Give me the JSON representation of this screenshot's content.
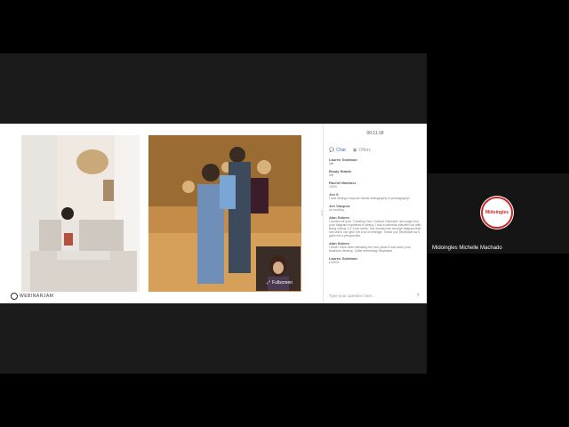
{
  "stage": {
    "brand": "WEBINARJAM",
    "fullscreen_label": "Fullscreen"
  },
  "chat": {
    "timer": "00:11:18",
    "tabs": [
      {
        "label": "Chat",
        "active": true
      },
      {
        "label": "Offers",
        "active": false
      }
    ],
    "messages": [
      {
        "name": "Lauren Goldman",
        "text": "hiiii"
      },
      {
        "name": "Brady Statzle",
        "text": "hiiii"
      },
      {
        "name": "Rachel Martinez",
        "text": "100%"
      },
      {
        "name": "Jen S",
        "text": "I love filming it anyone needs videography or photography!"
      },
      {
        "name": "Jen Vazquez",
        "text": "so exciting"
      },
      {
        "name": "Alan Sideen",
        "text": "I printed off your \"Creating Your Content Calendar\" and page four your diagram explained it clearly. I had a calendar planned out with lining videos 1-2-3 per week. You showed me enough diagram that use video can give me a lot of mileage. Thank you Stephanie as it gave me a perspective."
      },
      {
        "name": "Alan Sideen",
        "text": "I think I have been following her four years!!! and seen your business develop. Quite interesting Stephanie"
      },
      {
        "name": "Lauren Goldman",
        "text": "LOOOL"
      }
    ],
    "input_placeholder": "Type your question here..."
  },
  "participant": {
    "name": "Midoingles Michelle Machado",
    "avatar_text": "Midoingles"
  }
}
